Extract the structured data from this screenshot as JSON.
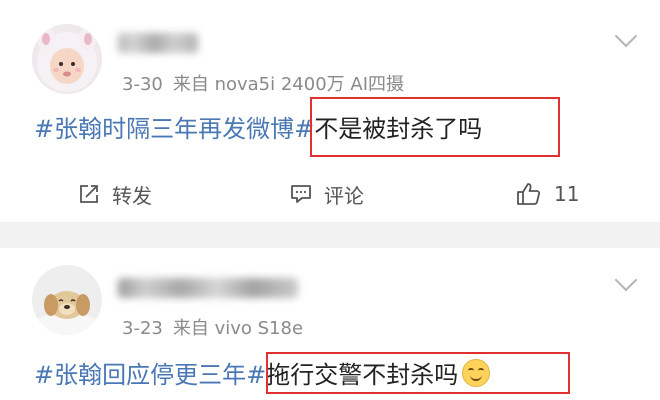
{
  "posts": [
    {
      "date": "3-30",
      "source": "来自 nova5i 2400万 AI四摄",
      "hashtag": "#张翰时隔三年再发微博#",
      "text": "不是被封杀了吗",
      "actions": {
        "forward_label": "转发",
        "comment_label": "评论",
        "like_count": "11"
      }
    },
    {
      "date": "3-23",
      "source": "来自 vivo S18e",
      "hashtag": "#张翰回应停更三年#",
      "text": "拖行交警不封杀吗",
      "emoji": "smile-emoji"
    }
  ],
  "icons": {
    "forward": "edit-share-icon",
    "comment": "comment-bubble-icon",
    "like": "thumbs-up-icon",
    "more": "chevron-down-icon"
  },
  "colors": {
    "hashtag": "#4a78b5",
    "highlight": "#e03030",
    "separator": "#f2f2f2",
    "meta": "#8a8a8a"
  }
}
